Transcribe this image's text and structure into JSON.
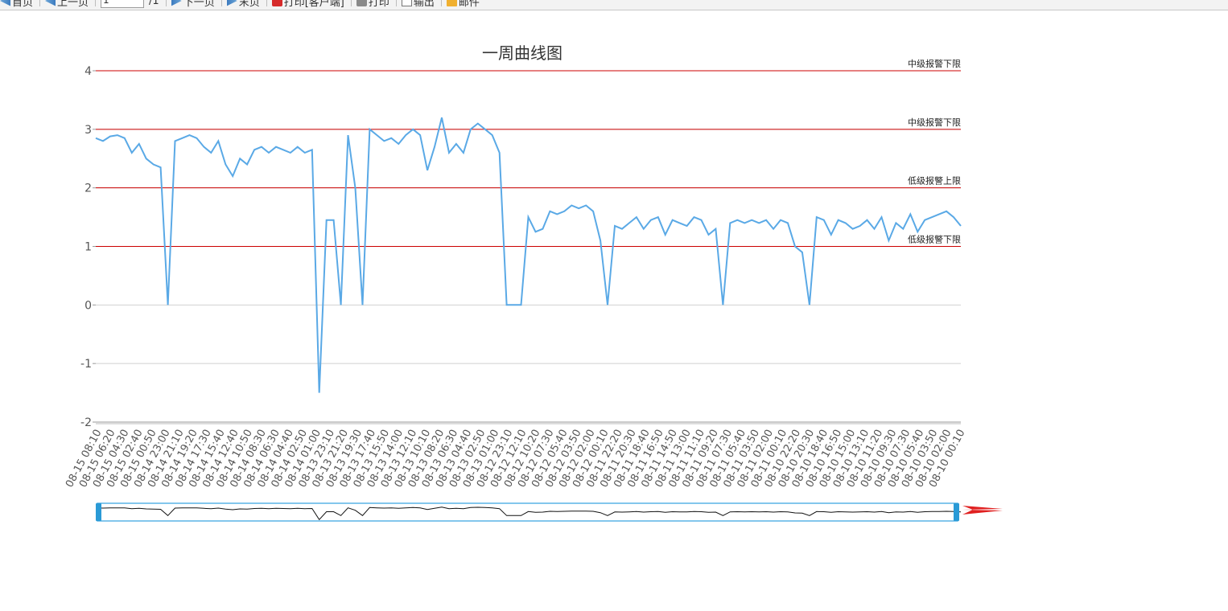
{
  "toolbar": {
    "items": [
      {
        "label": "首页",
        "icon": "first-page-icon"
      },
      {
        "label": "上一页",
        "icon": "prev-page-icon"
      },
      {
        "label": "1",
        "icon": "page-input"
      },
      {
        "label": "/1",
        "icon": ""
      },
      {
        "label": "下一页",
        "icon": "next-page-icon"
      },
      {
        "label": "末页",
        "icon": "last-page-icon"
      },
      {
        "label": "打印[客户端]",
        "icon": "pdf-icon"
      },
      {
        "label": "打印",
        "icon": "print-icon"
      },
      {
        "label": "输出",
        "icon": "export-icon"
      },
      {
        "label": "邮件",
        "icon": "mail-icon"
      }
    ]
  },
  "chart_data": {
    "type": "line",
    "title": "一周曲线图",
    "xlabel": "",
    "ylabel": "",
    "ylim": [
      -2,
      4
    ],
    "yticks": [
      "4",
      "3",
      "2",
      "1",
      "0",
      "-1",
      "-2"
    ],
    "grid": true,
    "line_color": "#5aa9e6",
    "x": [
      "08-15 08:10",
      "08-15 06:20",
      "08-15 04:30",
      "08-15 02:40",
      "08-15 00:50",
      "08-14 23:00",
      "08-14 21:10",
      "08-14 19:20",
      "08-14 17:30",
      "08-14 15:40",
      "08-14 12:40",
      "08-14 10:50",
      "08-14 08:30",
      "08-14 06:30",
      "08-14 04:40",
      "08-14 02:50",
      "08-14 01:00",
      "08-13 23:10",
      "08-13 21:20",
      "08-13 19:30",
      "08-13 17:40",
      "08-13 15:50",
      "08-13 14:00",
      "08-13 12:10",
      "08-13 10:10",
      "08-13 08:20",
      "08-13 06:30",
      "08-13 04:40",
      "08-13 02:50",
      "08-13 01:00",
      "08-12 23:10",
      "08-12 12:10",
      "08-12 10:20",
      "08-12 07:30",
      "08-12 05:40",
      "08-12 03:50",
      "08-12 02:00",
      "08-12 00:10",
      "08-11 22:20",
      "08-11 20:30",
      "08-11 18:40",
      "08-11 16:50",
      "08-11 14:50",
      "08-11 13:00",
      "08-11 11:10",
      "08-11 09:20",
      "08-11 07:30",
      "08-11 05:40",
      "08-11 03:50",
      "08-11 02:00",
      "08-11 00:10",
      "08-10 22:20",
      "08-10 20:30",
      "08-10 18:40",
      "08-10 16:50",
      "08-10 15:00",
      "08-10 13:10",
      "08-10 11:20",
      "08-10 09:30",
      "08-10 07:30",
      "08-10 05:40",
      "08-10 03:50",
      "08-10 02:00",
      "08-10 00:10"
    ],
    "series": [
      {
        "values": [
          2.85,
          2.8,
          2.88,
          2.9,
          2.85,
          2.6,
          2.75,
          2.5,
          2.4,
          2.35,
          0.0,
          2.8,
          2.85,
          2.9,
          2.85,
          2.7,
          2.6,
          2.8,
          2.4,
          2.2,
          2.5,
          2.4,
          2.65,
          2.7,
          2.6,
          2.7,
          2.65,
          2.6,
          2.7,
          2.6,
          2.65,
          -1.5,
          1.45,
          1.45,
          0.0,
          2.9,
          2.0,
          0.0,
          3.0,
          2.9,
          2.8,
          2.85,
          2.75,
          2.9,
          3.0,
          2.9,
          2.3,
          2.7,
          3.2,
          2.6,
          2.75,
          2.6,
          3.0,
          3.1,
          3.0,
          2.9,
          2.6,
          0.0,
          0.0,
          0.0,
          1.5,
          1.25,
          1.3,
          1.6,
          1.55,
          1.6,
          1.7,
          1.65,
          1.7,
          1.6,
          1.1,
          0.0,
          1.35,
          1.3,
          1.4,
          1.5,
          1.3,
          1.45,
          1.5,
          1.2,
          1.45,
          1.4,
          1.35,
          1.5,
          1.45,
          1.2,
          1.3,
          0.0,
          1.4,
          1.45,
          1.4,
          1.45,
          1.4,
          1.45,
          1.3,
          1.45,
          1.4,
          1.0,
          0.9,
          0.0,
          1.5,
          1.45,
          1.2,
          1.45,
          1.4,
          1.3,
          1.35,
          1.45,
          1.3,
          1.5,
          1.1,
          1.4,
          1.3,
          1.55,
          1.25,
          1.45,
          1.5,
          1.55,
          1.6,
          1.5,
          1.35
        ]
      }
    ],
    "reference_lines": [
      {
        "value": 4,
        "label": "中级报警下限",
        "color": "#cc0000"
      },
      {
        "value": 3,
        "label": "中级报警下限",
        "color": "#cc0000"
      },
      {
        "value": 2,
        "label": "低级报警上限",
        "color": "#cc0000"
      },
      {
        "value": 1,
        "label": "低级报警下限",
        "color": "#cc0000"
      }
    ],
    "zoom_slider": {
      "range": [
        0,
        100
      ],
      "handle_color": "#2a9ad6"
    }
  }
}
